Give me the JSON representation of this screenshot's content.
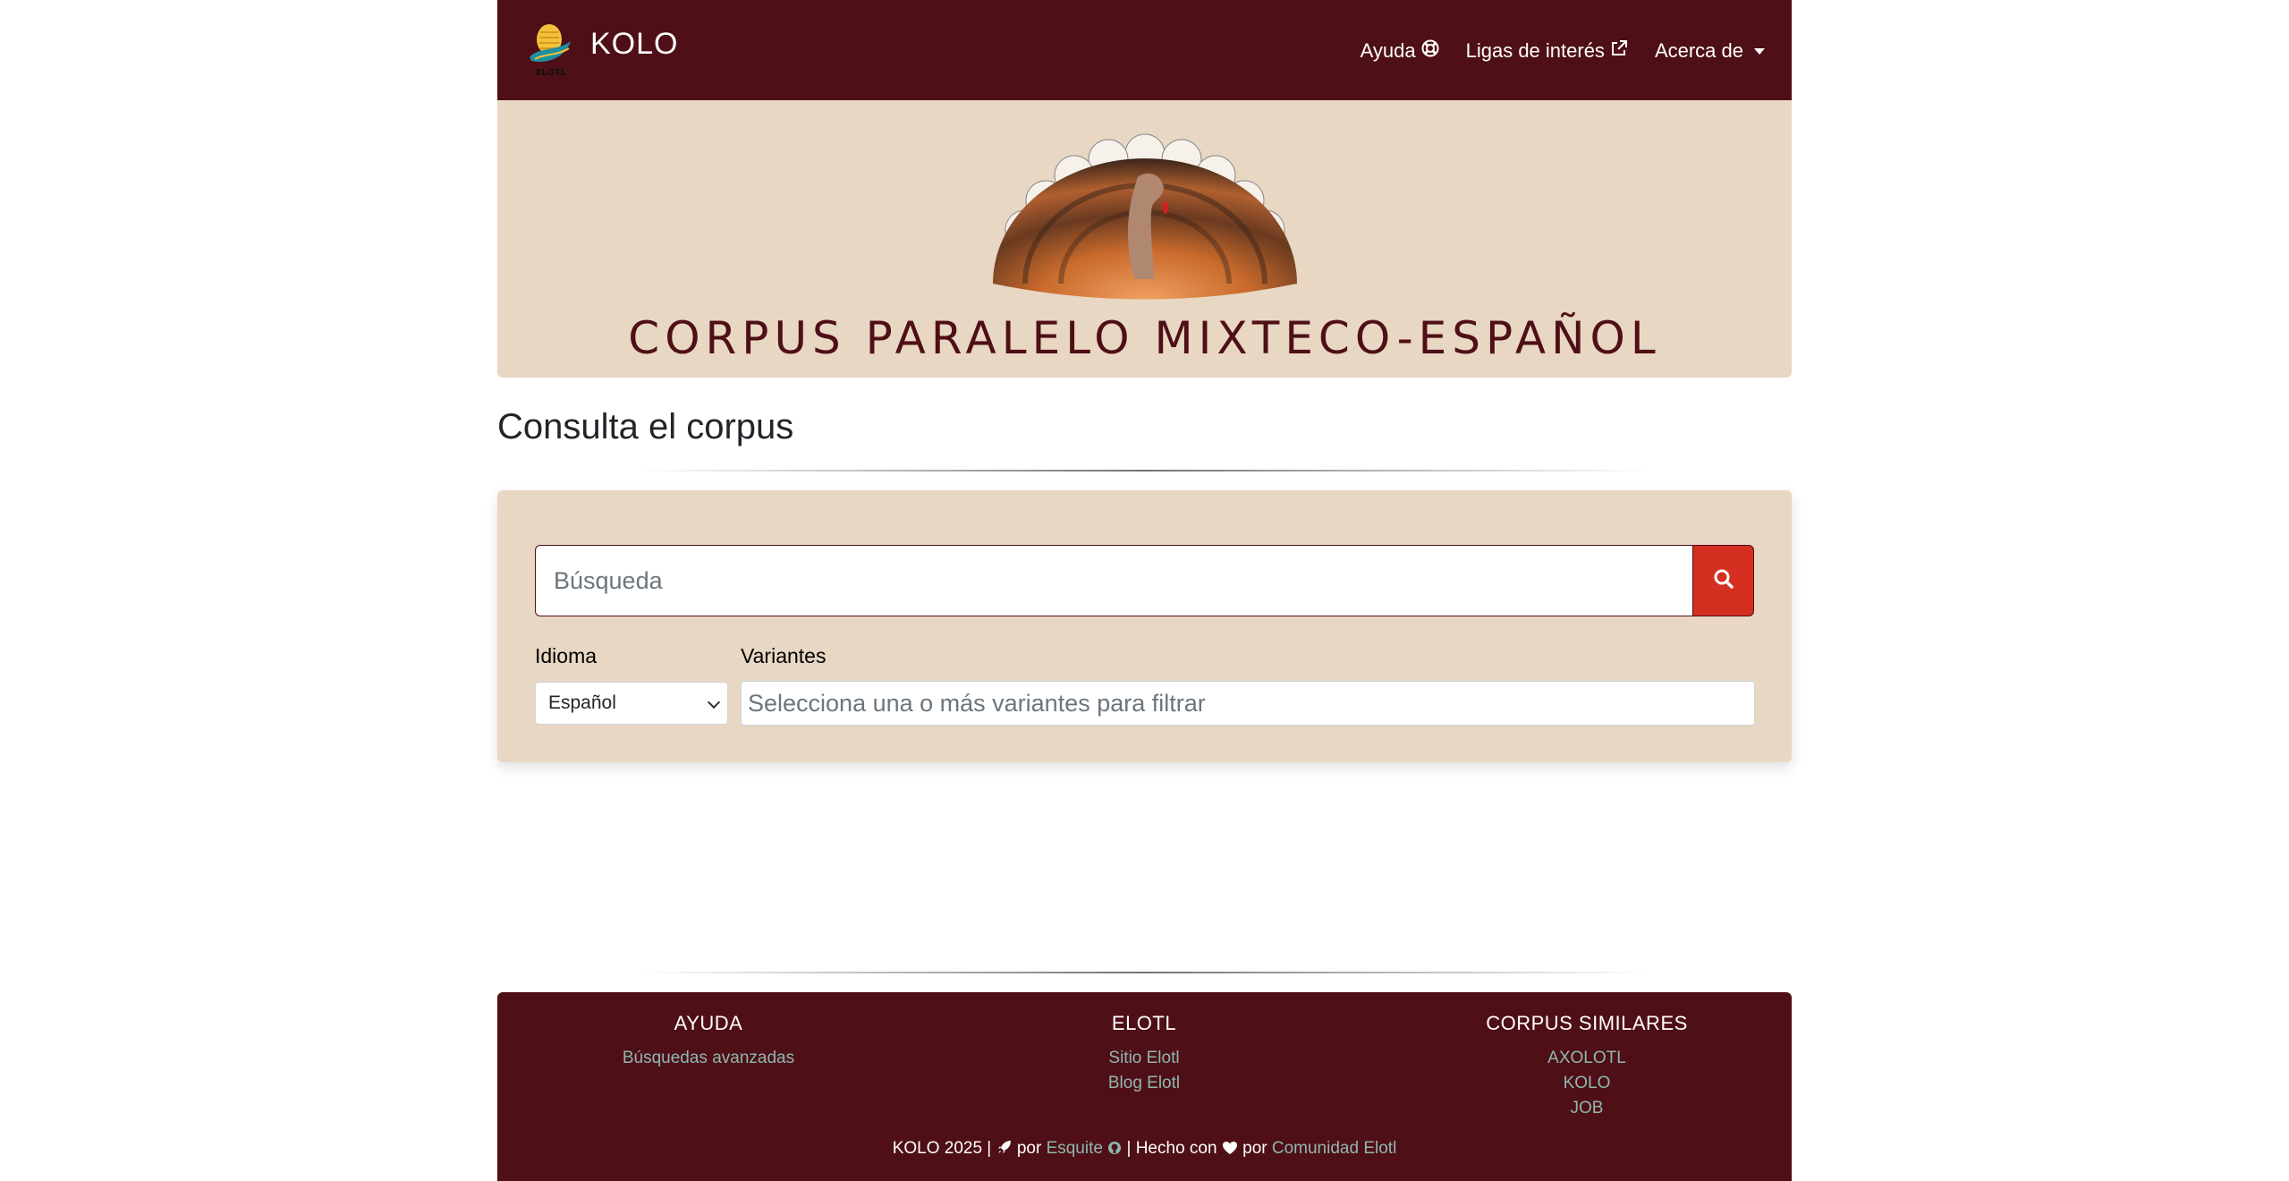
{
  "navbar": {
    "brand": "KOLO",
    "logo_text": "ELOTL",
    "links": [
      {
        "label": "Ayuda",
        "icon": "lifebuoy-icon"
      },
      {
        "label": "Ligas de interés",
        "icon": "external-link-icon"
      },
      {
        "label": "Acerca de",
        "icon": "caret-down-icon"
      }
    ]
  },
  "banner": {
    "title": "CORPUS PARALELO MIXTECO-ESPAÑOL",
    "illustration": "turkey"
  },
  "main": {
    "heading": "Consulta el corpus",
    "search": {
      "placeholder": "Búsqueda",
      "value": "",
      "button_icon": "search-icon"
    },
    "language": {
      "label": "Idioma",
      "selected": "Español"
    },
    "variants": {
      "label": "Variantes",
      "placeholder": "Selecciona una o más variantes para filtrar"
    }
  },
  "footer": {
    "columns": [
      {
        "title": "AYUDA",
        "links": [
          "Búsquedas avanzadas"
        ]
      },
      {
        "title": "ELOTL",
        "links": [
          "Sitio Elotl",
          "Blog Elotl"
        ]
      },
      {
        "title": "CORPUS SIMILARES",
        "links": [
          "AXOLOTL",
          "KOLO",
          "JOB"
        ]
      }
    ],
    "bottom": {
      "prefix": "KOLO 2025 |",
      "por1": "por",
      "author": "Esquite",
      "made_with": "| Hecho con",
      "por2": "por",
      "community": "Comunidad Elotl"
    }
  },
  "colors": {
    "primary": "#4f0f16",
    "beige": "#e8d7c3",
    "accent_red": "#d42f20",
    "link_teal": "#8fb7b1"
  }
}
